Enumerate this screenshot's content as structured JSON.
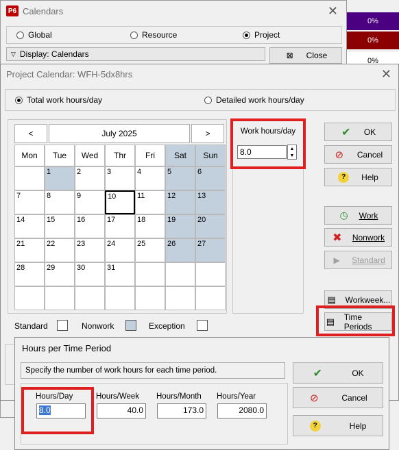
{
  "calendars_window": {
    "title": "Calendars",
    "logo": "P6",
    "radios": [
      {
        "label": "Global",
        "selected": false
      },
      {
        "label": "Resource",
        "selected": false
      },
      {
        "label": "Project",
        "selected": true
      }
    ],
    "display_label": "Display: Calendars",
    "close_label": "Close"
  },
  "progress_column": [
    "0%",
    "0%",
    "0%"
  ],
  "progress_colors": [
    "#4b0082",
    "#8b0000",
    "#ffffff"
  ],
  "project_dialog": {
    "title": "Project Calendar: WFH-5dx8hrs",
    "mode_options": [
      {
        "label": "Total work hours/day",
        "selected": true
      },
      {
        "label": "Detailed work hours/day",
        "selected": false
      }
    ],
    "month_label": "July 2025",
    "prev": "<",
    "next": ">",
    "weekdays": [
      "Mon",
      "Tue",
      "Wed",
      "Thr",
      "Fri",
      "Sat",
      "Sun"
    ],
    "weeks": [
      [
        "",
        "1",
        "2",
        "3",
        "4",
        "5",
        "6"
      ],
      [
        "7",
        "8",
        "9",
        "10",
        "11",
        "12",
        "13"
      ],
      [
        "14",
        "15",
        "16",
        "17",
        "18",
        "19",
        "20"
      ],
      [
        "21",
        "22",
        "23",
        "24",
        "25",
        "26",
        "27"
      ],
      [
        "28",
        "29",
        "30",
        "31",
        "",
        "",
        ""
      ],
      [
        "",
        "",
        "",
        "",
        "",
        "",
        ""
      ]
    ],
    "today": "10",
    "work_hours_label": "Work hours/day",
    "work_hours_value": "8.0",
    "legend": [
      "Standard",
      "Nonwork",
      "Exception"
    ],
    "buttons": {
      "ok": "OK",
      "cancel": "Cancel",
      "help": "Help",
      "work": "Work",
      "nonwork": "Nonwork",
      "standard": "Standard",
      "workweek": "Workweek...",
      "time_periods": "Time Periods"
    }
  },
  "hours_dialog": {
    "title": "Hours per Time Period",
    "instruction": "Specify the number of work hours for each time period.",
    "fields": [
      {
        "label": "Hours/Day",
        "value": "8.0"
      },
      {
        "label": "Hours/Week",
        "value": "40.0"
      },
      {
        "label": "Hours/Month",
        "value": "173.0"
      },
      {
        "label": "Hours/Year",
        "value": "2080.0"
      }
    ],
    "ok": "OK",
    "cancel": "Cancel",
    "help": "Help"
  }
}
